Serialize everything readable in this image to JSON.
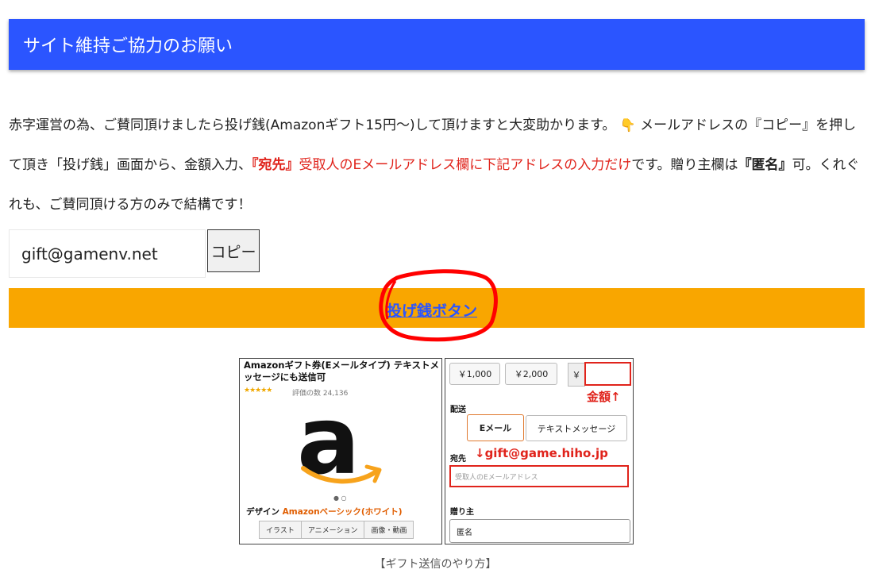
{
  "header": {
    "title": "サイト維持ご協力のお願い"
  },
  "intro": {
    "part1": "赤字運営の為、ご賛同頂けましたら投げ銭(Amazonギフト15円〜)して頂けますと大変助かります。",
    "emoji": "👇",
    "part2": "メールアドレスの『コピー』を押して頂き「投げ銭」画面から、金額入力、",
    "red_bold": "『宛先』",
    "red_text": "受取人のEメールアドレス欄に下記アドレスの入力だけ",
    "part3": "です。贈り主欄は",
    "bold_text": "『匿名』",
    "part4": "可。くれぐれも、ご賛同頂ける方のみで結構です！"
  },
  "copy_box": {
    "email": "gift@gamenv.net",
    "button_label": "コピー"
  },
  "donate": {
    "link_label": "投げ銭ボタン",
    "bar_color": "#f9a600",
    "circle_color": "#ff0000"
  },
  "figure": {
    "left_panel": {
      "title": "Amazonギフト券(Eメールタイプ) テキストメッセージにも送信可",
      "stars": "★★★★★",
      "reviews": "評価の数 24,136",
      "logo_letter": "a",
      "carousel_dots": "● ○",
      "design_label": "デザイン",
      "design_value": "Amazonベーシック(ホワイト)",
      "tabs": [
        "イラスト",
        "アニメーション",
        "画像・動画"
      ]
    },
    "right_panel": {
      "amounts": [
        "￥1,000",
        "￥2,000"
      ],
      "yen_symbol": "￥",
      "kingaku_note": "金額↑",
      "delivery_label": "配送",
      "tab_email": "Eメール",
      "tab_text": "テキストメッセージ",
      "to_label": "宛先",
      "gift_address_note": "↓gift@game.hiho.jp",
      "recipient_placeholder": "受取人のEメールアドレス",
      "sender_label": "贈り主",
      "sender_value": "匿名"
    },
    "caption": "【ギフト送信のやり方】"
  }
}
